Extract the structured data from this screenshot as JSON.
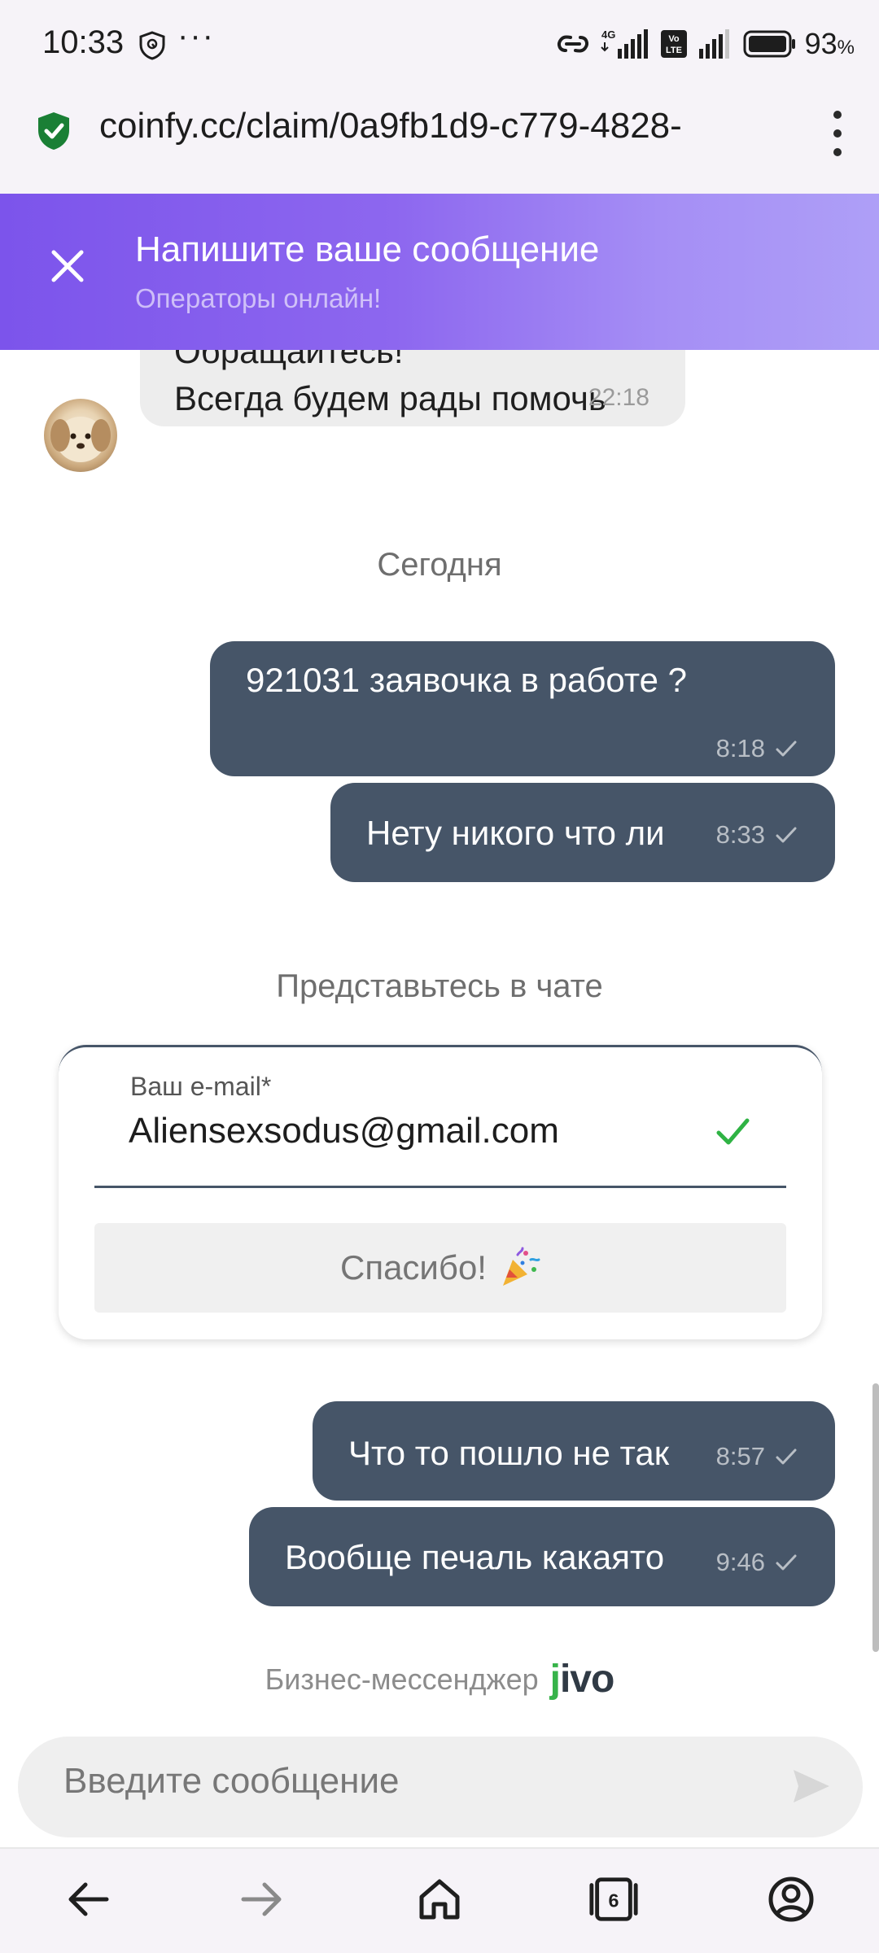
{
  "status_bar": {
    "time": "10:33",
    "dots": "···",
    "network_4g": "4G",
    "volte": "VoLTE",
    "battery_percent": "93",
    "battery_unit": "%"
  },
  "browser": {
    "url": "coinfy.cc/claim/0a9fb1d9-c779-4828-",
    "tab_count": "6"
  },
  "chat_header": {
    "title": "Напишите ваше сообщение",
    "subtitle": "Операторы онлайн!"
  },
  "operator_message": {
    "line_top": "Обращайтесь!",
    "line_main": "Всегда будем рады помочь",
    "time": "22:18"
  },
  "date_separator": "Сегодня",
  "user_messages": [
    {
      "text": "921031 заявочка в работе ?",
      "time": "8:18"
    },
    {
      "text": "Нету никого что ли",
      "time": "8:33"
    },
    {
      "text": "Что то пошло не так",
      "time": "8:57"
    },
    {
      "text": "Вообще печаль какаято",
      "time": "9:46"
    }
  ],
  "intro_form": {
    "heading": "Представьтесь в чате",
    "email_label": "Ваш e-mail*",
    "email_value": "Aliensexsodus@gmail.com",
    "thanks_label": "Спасибо!"
  },
  "branding": {
    "text": "Бизнес-мессенджер",
    "logo": "jivo"
  },
  "composer": {
    "placeholder": "Введите сообщение"
  },
  "colors": {
    "header_gradient_start": "#7c54eb",
    "header_gradient_end": "#ae9ff7",
    "user_bubble": "#465568",
    "operator_bubble": "#ededed",
    "check_green": "#2fb344"
  },
  "icons": [
    "shield-icon",
    "signal-icon",
    "battery-icon",
    "lock-icon",
    "menu-icon",
    "close-icon",
    "checkmark-icon",
    "party-popper-icon",
    "send-icon",
    "back-icon",
    "forward-icon",
    "home-icon",
    "tabs-icon",
    "profile-icon"
  ]
}
